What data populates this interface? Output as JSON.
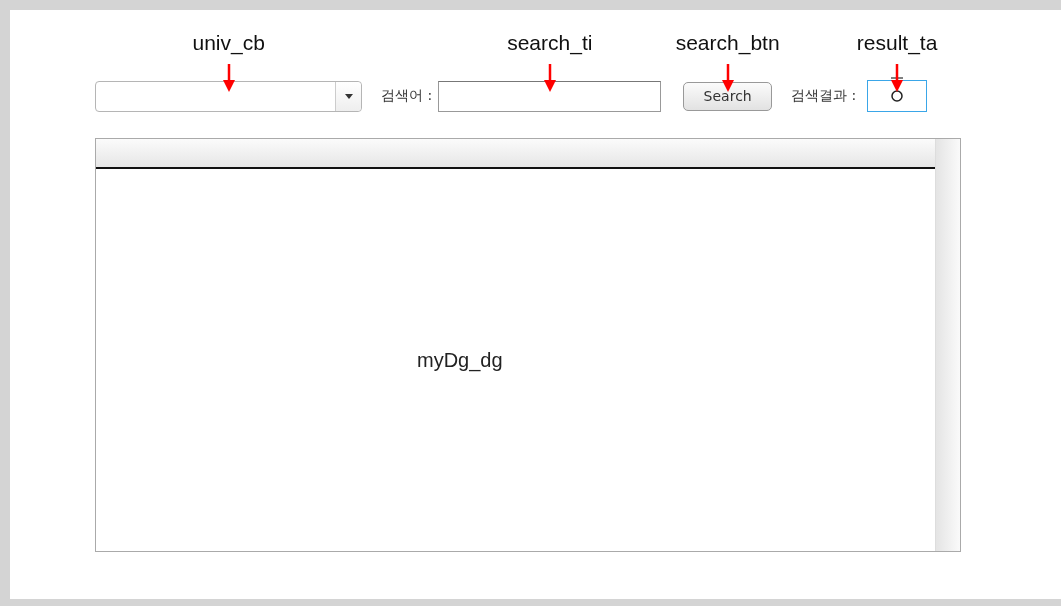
{
  "toolbar": {
    "search_label": "검색어 :",
    "search_button": "Search",
    "result_label": "검색결과 :"
  },
  "annotations": [
    {
      "label": "univ_cb"
    },
    {
      "label": "search_ti"
    },
    {
      "label": "search_btn"
    },
    {
      "label": "result_ta"
    }
  ],
  "grid_label": "myDg_dg"
}
